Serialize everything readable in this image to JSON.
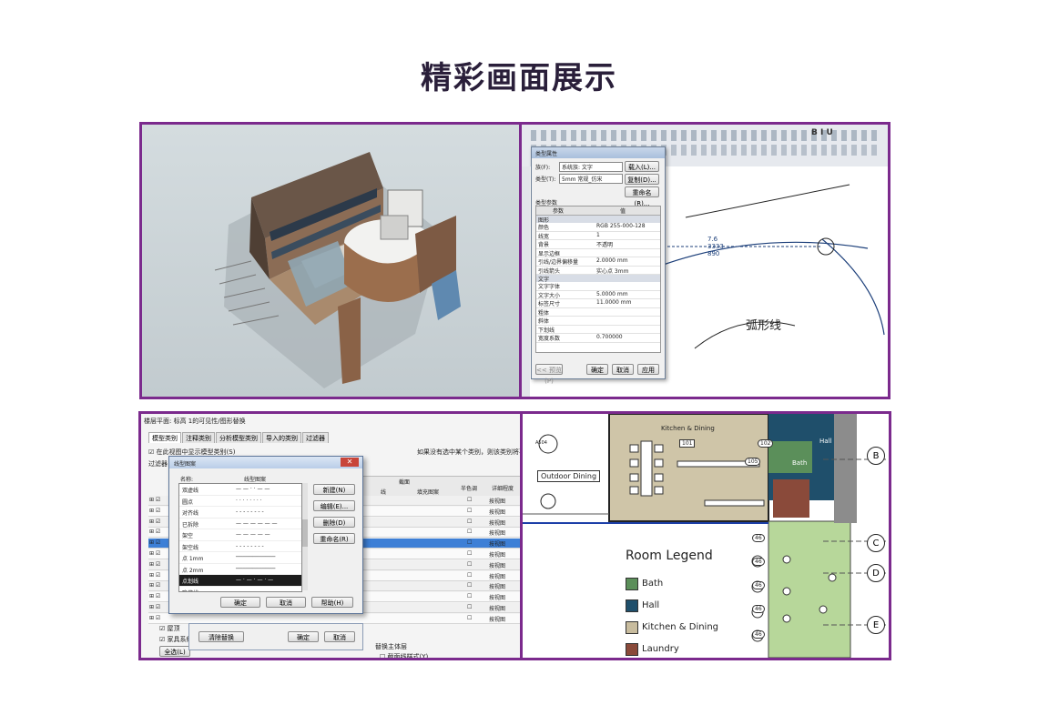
{
  "title": "精彩画面展示",
  "panel_revit_dialog": {
    "dialog_title": "类型属性",
    "family_label": "族(F):",
    "family_value": "系统族: 文字",
    "type_label": "类型(T):",
    "type_value": "5mm 常规_仿宋",
    "load_button": "载入(L)...",
    "duplicate_button": "复制(D)...",
    "rename_button": "重命名(R)...",
    "params_label": "类型参数",
    "col_param": "参数",
    "col_value": "值",
    "group_graphics": "图形",
    "group_text": "文字",
    "rows": [
      {
        "name": "颜色",
        "value": "RGB 255-000-128"
      },
      {
        "name": "线宽",
        "value": "1"
      },
      {
        "name": "背景",
        "value": "不透明"
      },
      {
        "name": "显示边框",
        "value": ""
      },
      {
        "name": "引线/边界偏移量",
        "value": "2.0000 mm"
      },
      {
        "name": "引线箭头",
        "value": "实心点 3mm"
      }
    ],
    "text_rows": [
      {
        "name": "文字字体",
        "value": ""
      },
      {
        "name": "文字大小",
        "value": "5.0000 mm"
      },
      {
        "name": "标签尺寸",
        "value": "11.0000 mm"
      },
      {
        "name": "粗体",
        "value": ""
      },
      {
        "name": "斜体",
        "value": ""
      },
      {
        "name": "下划线",
        "value": ""
      },
      {
        "name": "宽度系数",
        "value": "0.700000"
      }
    ],
    "preview_button": "<< 预览(P)",
    "ok_button": "确定",
    "cancel_button": "取消",
    "apply_button": "应用",
    "drawing_text": "弧形线",
    "tag_lines": [
      "7.6",
      "3333",
      "890"
    ]
  },
  "panel_visibility": {
    "window_title": "楼层平面: 标高 1的可见性/图形替换",
    "tabs": [
      "模型类别",
      "注释类别",
      "分析模型类别",
      "导入的类别",
      "过滤器"
    ],
    "show_checkbox": "在此视图中显示模型类别(S)",
    "hint": "如果没有选中某个类别，则该类别将不可见",
    "filter_label": "过滤器",
    "cols": [
      "截面",
      "线",
      "填充图案",
      "半色调",
      "详细程度"
    ],
    "detail_value": "按视图",
    "bottom_items": [
      "屋顶",
      "家具系统"
    ],
    "select_all": "全选(L)",
    "clear_override": "清除替换",
    "ok": "确定",
    "cancel": "取消",
    "replace_host": "替换主体层",
    "cut_line": "截面线样式(Y)",
    "linepattern_dialog": {
      "title": "线型图案",
      "col_name": "名称:",
      "col_pattern": "线型图案",
      "items": [
        "双虚线",
        "圆点",
        "对齐线",
        "已拆除",
        "架空",
        "架空线",
        "点 1mm",
        "点 2mm",
        "点划线",
        "隐藏线"
      ],
      "selected_index": 8,
      "buttons": [
        "新建(N)",
        "编辑(E)...",
        "删除(D)",
        "重命名(R)"
      ],
      "ok": "确定",
      "cancel": "取消",
      "help": "帮助(H)"
    }
  },
  "panel_plan": {
    "kitchen_label": "Kitchen & Dining",
    "room_number": "101",
    "outdoor_label": "Outdoor Dining",
    "section_tag": "A504",
    "legend_title": "Room Legend",
    "legend": [
      {
        "label": "Bath",
        "color": "#5b8f5a"
      },
      {
        "label": "Hall",
        "color": "#1f4f6b"
      },
      {
        "label": "Kitchen & Dining",
        "color": "#c8bc9e"
      },
      {
        "label": "Laundry",
        "color": "#8a4a3a"
      }
    ],
    "grid_bubbles": [
      "B",
      "C",
      "D",
      "E"
    ],
    "hall_label": "Hall",
    "bath_label": "Bath",
    "small_tags": [
      "105",
      "102",
      "46",
      "46",
      "46",
      "46",
      "46"
    ]
  }
}
